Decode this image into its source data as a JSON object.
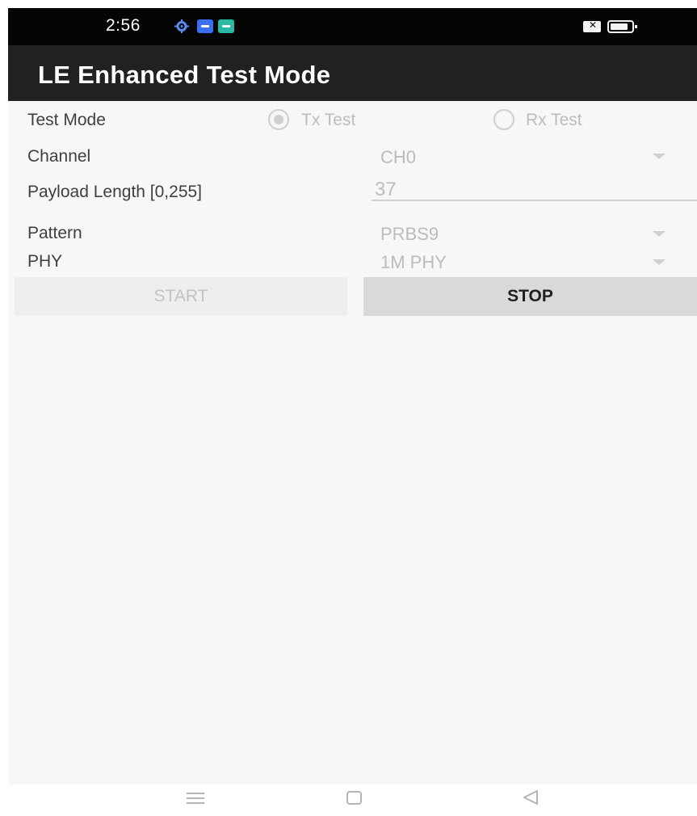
{
  "status_bar": {
    "time": "2:56",
    "icons": [
      "gear-icon",
      "app-icon",
      "app-icon",
      "sim-icon",
      "battery-icon"
    ],
    "sim_glyph": "✕"
  },
  "app_bar": {
    "title": "LE Enhanced Test Mode"
  },
  "form": {
    "test_mode": {
      "label": "Test Mode",
      "options": [
        {
          "label": "Tx Test",
          "selected": true
        },
        {
          "label": "Rx Test",
          "selected": false
        }
      ]
    },
    "channel": {
      "label": "Channel",
      "value": "CH0"
    },
    "payload_length": {
      "label": "Payload Length [0,255]",
      "value": "37"
    },
    "pattern": {
      "label": "Pattern",
      "value": "PRBS9"
    },
    "phy": {
      "label": "PHY",
      "value": "1M PHY"
    }
  },
  "buttons": {
    "start": "START",
    "stop": "STOP"
  },
  "nav_bar": {
    "icons": [
      "menu-icon",
      "home-icon",
      "back-icon"
    ]
  },
  "colors": {
    "status_bar": "#050505",
    "app_bar": "#212121",
    "content_bg": "#f7f7f7",
    "disabled_text": "#bcbcbc",
    "label_text": "#3f3f3f"
  }
}
